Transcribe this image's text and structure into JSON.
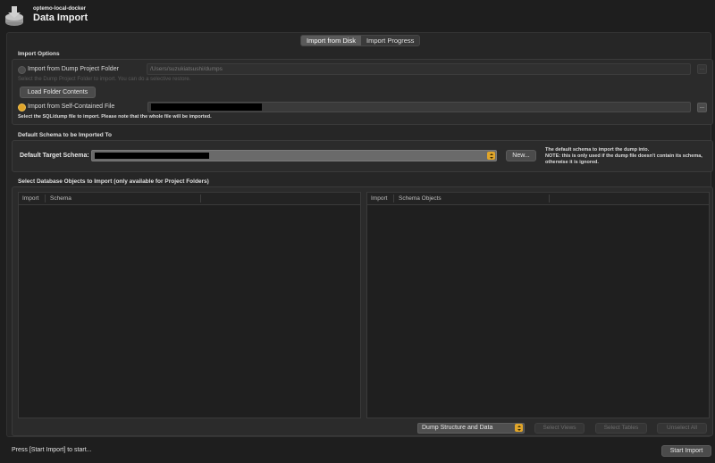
{
  "header": {
    "connection": "optemo-local-docker",
    "title": "Data Import",
    "icon": "database-import-icon"
  },
  "tabs": [
    {
      "label": "Import from Disk",
      "active": true
    },
    {
      "label": "Import Progress",
      "active": false
    }
  ],
  "import_options": {
    "section_label": "Import Options",
    "project_folder": {
      "label": "Import from Dump Project Folder",
      "selected": false,
      "path": "/Users/suzukiatsushi/dumps",
      "hint": "Select the Dump Project Folder to import. You can do a selective restore.",
      "browse_label": "...",
      "load_button": "Load Folder Contents"
    },
    "self_contained": {
      "label": "Import from Self-Contained File",
      "selected": true,
      "browse_label": "...",
      "hint": "Select the SQL/dump file to import. Please note that the whole file will be imported."
    }
  },
  "default_schema": {
    "section_label": "Default Schema to be Imported To",
    "label": "Default Target Schema:",
    "new_button": "New...",
    "note_line1": "The default schema to import the dump into.",
    "note_line2": "NOTE: this is only used if the dump file doesn't contain its schema,",
    "note_line3": "otherwise it is ignored."
  },
  "objects": {
    "section_label": "Select Database Objects to Import (only available for Project Folders)",
    "left_table": {
      "columns": [
        "Import",
        "Schema"
      ]
    },
    "right_table": {
      "columns": [
        "Import",
        "Schema Objects"
      ]
    },
    "dump_option": "Dump Structure and Data",
    "select_views": "Select Views",
    "select_tables": "Select Tables",
    "unselect_all": "Unselect All"
  },
  "footer": {
    "status": "Press [Start Import] to start...",
    "start_button": "Start Import"
  },
  "colors": {
    "accent": "#e0a52a",
    "background": "#1e1e1e",
    "panel": "#2b2b2b"
  }
}
